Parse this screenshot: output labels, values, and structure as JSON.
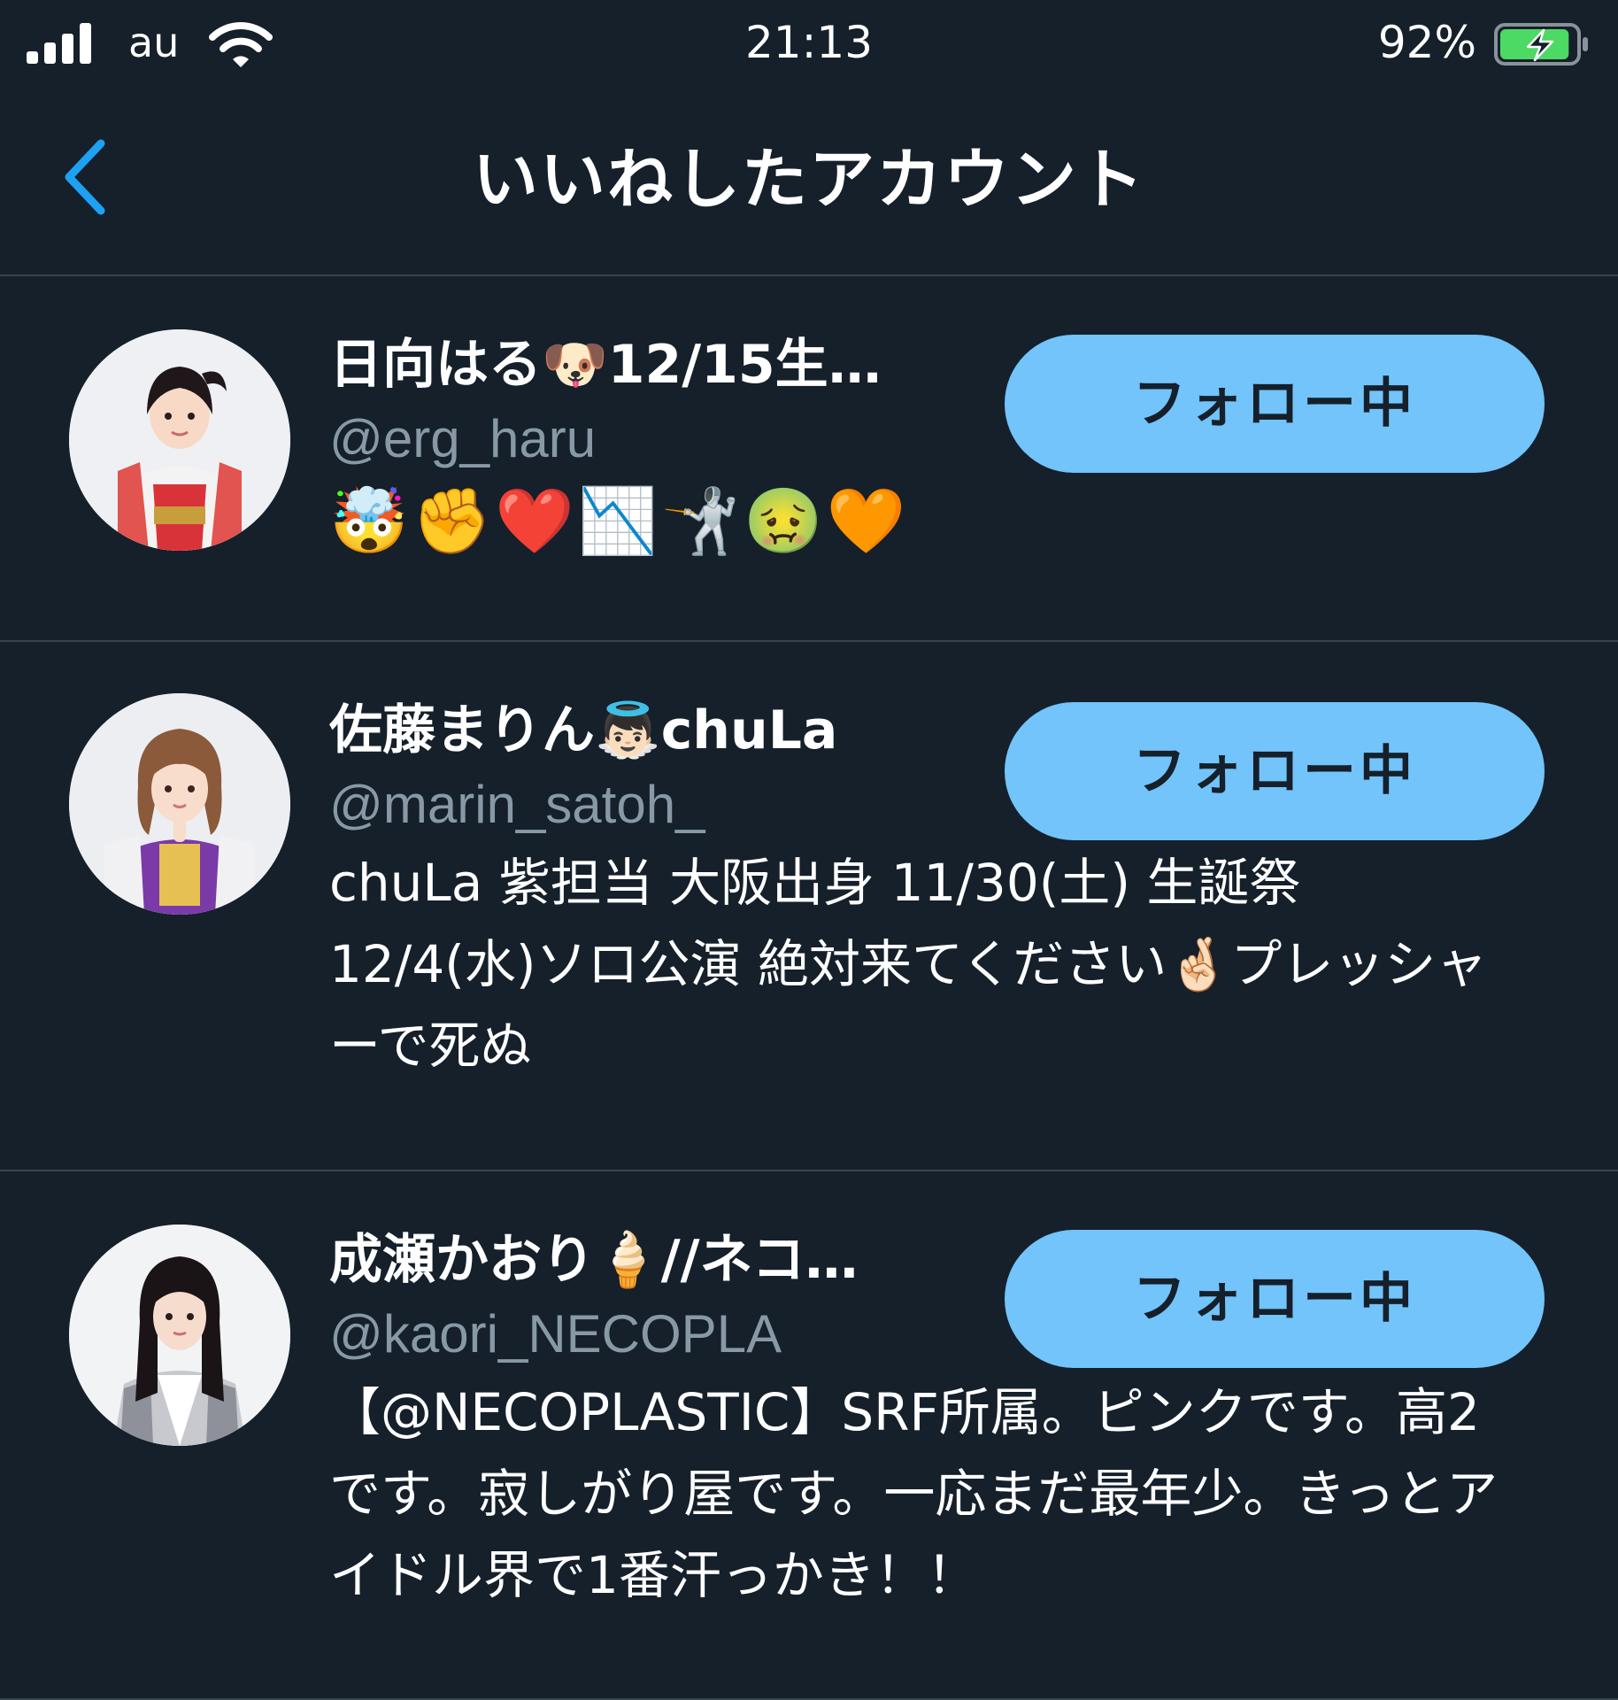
{
  "status_bar": {
    "carrier": "au",
    "time": "21:13",
    "battery_percent": "92%",
    "battery_level": 0.92,
    "battery_color": "#4cd964",
    "charging": true
  },
  "header": {
    "title": "いいねしたアカウント",
    "back_icon": "chevron-left-icon",
    "accent_color": "#1da1f2"
  },
  "users": [
    {
      "display_name": "日向はる🐶12/15生…",
      "handle": "@erg_haru",
      "bio": "🤯✊❤️📉🤺🤢🧡",
      "follow_label": "フォロー中"
    },
    {
      "display_name": "佐藤まりん👼🏻chuLa",
      "handle": "@marin_satoh_",
      "bio": "chuLa 紫担当 大阪出身 11/30(土) 生誕祭 12/4(水)ソロ公演 絶対来てください🤞🏻プレッシャーで死ぬ",
      "follow_label": "フォロー中"
    },
    {
      "display_name": "成瀬かおり🍦//ネコ…",
      "handle": "@kaori_NECOPLA",
      "bio": "【@NECOPLASTIC】SRF所属。ピンクです。高2です。寂しがり屋です。一応まだ最年少。きっとアイドル界で1番汗っかき！！",
      "follow_label": "フォロー中"
    }
  ],
  "theme": {
    "background": "#15202b",
    "divider": "#38444d",
    "secondary_text": "#8899a6",
    "follow_button_bg": "#72c4fa"
  }
}
